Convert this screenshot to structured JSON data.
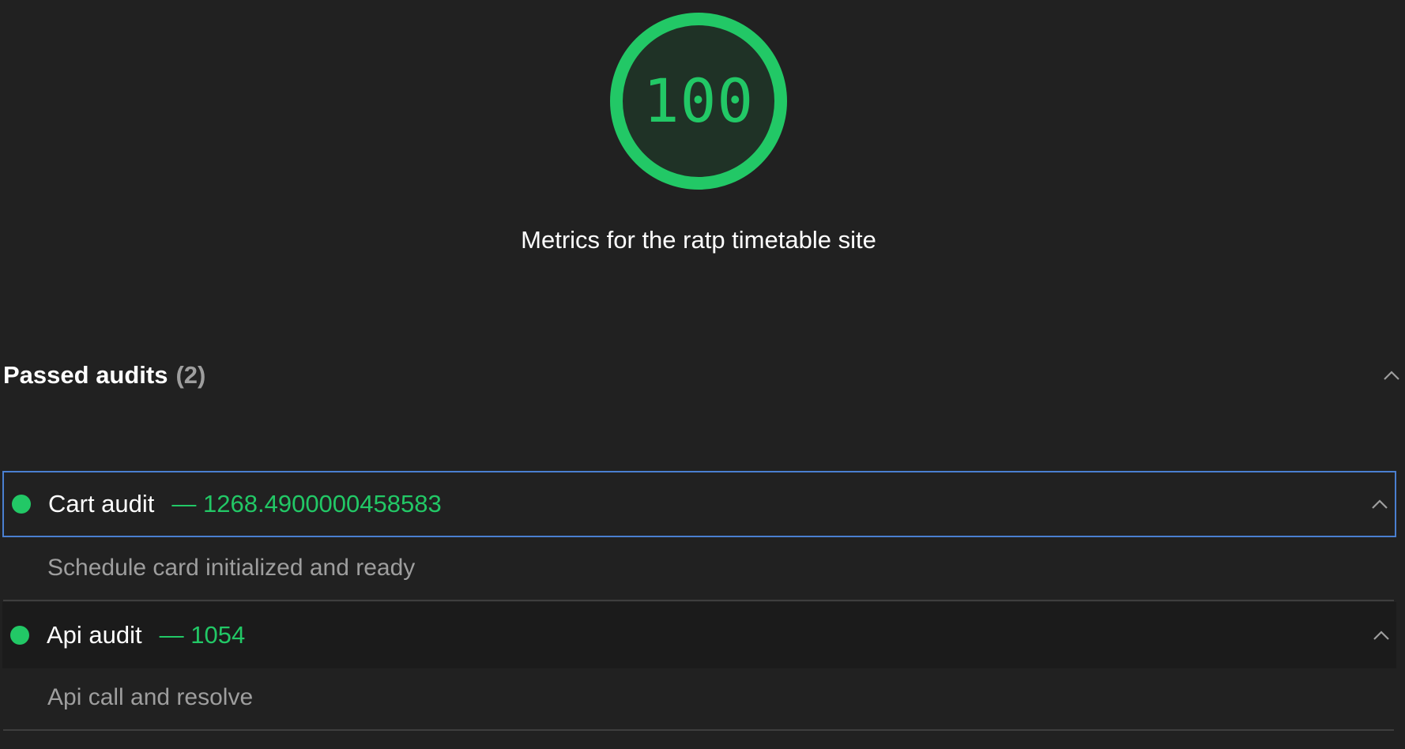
{
  "gauge": {
    "score": "100",
    "title": "Metrics for the ratp timetable site"
  },
  "passed_group": {
    "title": "Passed audits",
    "count": "(2)"
  },
  "audits": [
    {
      "title": "Cart audit",
      "value": "— 1268.4900000458583",
      "description": "Schedule card initialized and ready"
    },
    {
      "title": "Api audit",
      "value": "— 1054",
      "description": "Api call and resolve"
    }
  ],
  "colors": {
    "pass": "#22c866",
    "focus_border": "#4a7fd0",
    "background": "#212121"
  },
  "icons": [
    "chevron-up-icon",
    "pass-dot-icon"
  ]
}
